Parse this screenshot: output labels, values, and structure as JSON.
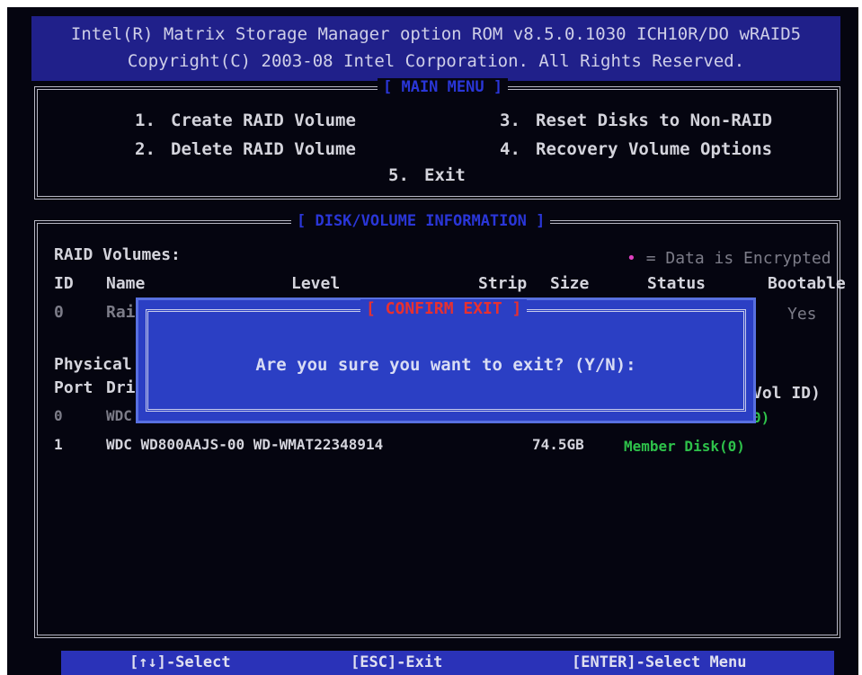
{
  "header": {
    "line1": "Intel(R) Matrix Storage Manager option ROM v8.5.0.1030 ICH10R/DO wRAID5",
    "line2": "Copyright(C) 2003-08 Intel Corporation.  All Rights Reserved."
  },
  "main_menu": {
    "title": "[ MAIN MENU ]",
    "items": [
      {
        "num": "1.",
        "label": "Create RAID Volume"
      },
      {
        "num": "2.",
        "label": "Delete RAID Volume"
      },
      {
        "num": "3.",
        "label": "Reset Disks to Non-RAID"
      },
      {
        "num": "4.",
        "label": "Recovery Volume Options"
      },
      {
        "num": "5.",
        "label": "Exit"
      }
    ]
  },
  "disk_info": {
    "title": "[ DISK/VOLUME INFORMATION ]",
    "raid_volumes_label": "RAID Volumes:",
    "encrypted_note": "= Data is Encrypted",
    "volume_headers": {
      "id": "ID",
      "name": "Name",
      "level": "Level",
      "strip": "Strip",
      "size": "Size",
      "status": "Status",
      "bootable": "Bootable"
    },
    "volume_row": {
      "id": "0",
      "name": "Rai",
      "bootable": "Yes"
    },
    "physical_label": "Physical",
    "port_header": "Port",
    "drive_header": "Dri",
    "vol_id_header": "Vol ID)",
    "disks": [
      {
        "port": "0",
        "model": "WDC",
        "status": "0)"
      },
      {
        "port": "1",
        "model": "WDC WD800AAJS-00 WD-WMAT22348914",
        "size": "74.5GB",
        "status": "Member Disk(0)"
      }
    ]
  },
  "dialog": {
    "title": "[ CONFIRM EXIT ]",
    "message": "Are you sure you want to exit? (Y/N):"
  },
  "footer": {
    "select": "[↑↓]-Select",
    "exit": "[ESC]-Exit",
    "enter": "[ENTER]-Select Menu"
  },
  "colors": {
    "header_bg": "#20208a",
    "dialog_bg": "#2b3fc4",
    "dialog_title": "#e83030",
    "member_status": "#2ec14a",
    "encrypted_marker": "#e040c0"
  }
}
